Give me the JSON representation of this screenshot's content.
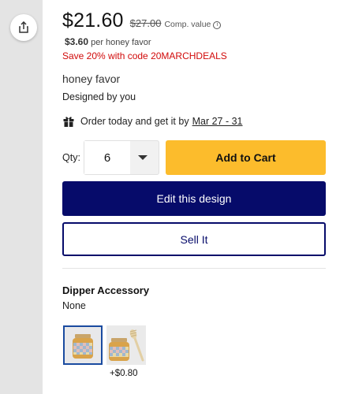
{
  "price": "$21.60",
  "compare_price": "$27.00",
  "compare_label": "Comp. value",
  "info_icon": "ⓘ",
  "unit_price": "$3.60",
  "unit_label": "per honey favor",
  "promo_text": "Save 20% with code 20MARCHDEALS",
  "product_name": "honey favor",
  "designer_text": "Designed by you",
  "delivery": {
    "text": "Order today and get it by",
    "dates": "Mar 27 - 31",
    "icon": "gift-icon"
  },
  "qty": {
    "label": "Qty:",
    "value": "6",
    "icon": "chevron-down-icon"
  },
  "buttons": {
    "add_to_cart": "Add to Cart",
    "edit_design": "Edit this design",
    "sell_it": "Sell It"
  },
  "accessory": {
    "title": "Dipper Accessory",
    "selected_value": "None",
    "options": [
      {
        "label": "",
        "selected": true
      },
      {
        "label": "+$0.80",
        "selected": false
      }
    ]
  },
  "share_icon": "share-icon",
  "colors": {
    "primary": "#060b6a",
    "cta": "#fcbc2c",
    "promo": "#d10a0a",
    "selected_border": "#1a4ba0"
  }
}
